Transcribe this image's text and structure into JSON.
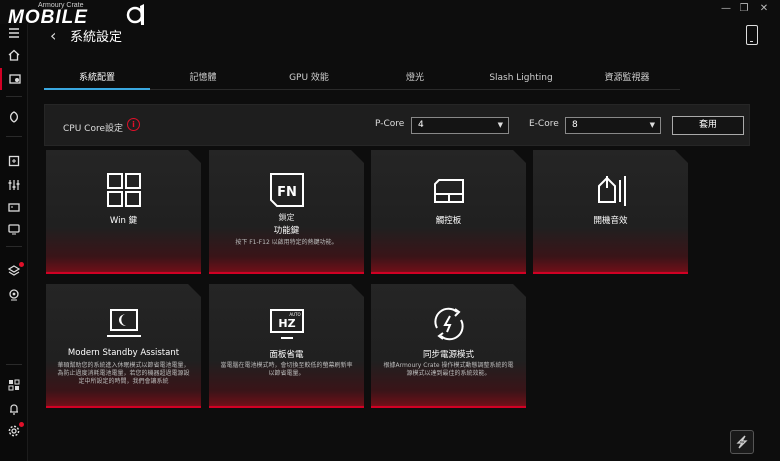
{
  "app": {
    "name": "Armoury Crate",
    "logo_text": "MOBILE"
  },
  "window_controls": {
    "minimize": "—",
    "restore": "❐",
    "close": "✕"
  },
  "header": {
    "back": "‹",
    "title": "系統設定"
  },
  "tabs": [
    {
      "label": "系統配置",
      "active": true
    },
    {
      "label": "記憶體",
      "active": false
    },
    {
      "label": "GPU 效能",
      "active": false
    },
    {
      "label": "燈光",
      "active": false
    },
    {
      "label": "Slash Lighting",
      "active": false
    },
    {
      "label": "資源監視器",
      "active": false
    }
  ],
  "config": {
    "label": "CPU Core設定",
    "info": "i",
    "pcore_label": "P-Core",
    "pcore_value": "4",
    "ecore_label": "E-Core",
    "ecore_value": "8",
    "caret": "▼",
    "apply_label": "套用"
  },
  "cards": [
    {
      "icon": "windows-grid-icon",
      "title": "Win 鍵",
      "subtitle": "",
      "desc": ""
    },
    {
      "icon": "fn-key-icon",
      "title": "鎖定",
      "subtitle": "功能鍵",
      "desc": "按下 F1-F12 以啟用特定的熱鍵功能。"
    },
    {
      "icon": "touchpad-icon",
      "title": "觸控板",
      "subtitle": "",
      "desc": ""
    },
    {
      "icon": "boot-sound-icon",
      "title": "開機音效",
      "subtitle": "",
      "desc": ""
    },
    {
      "icon": "modern-standby-icon",
      "title": "Modern Standby Assistant",
      "subtitle": "",
      "desc": "華碩幫助您的系統進入休眠模式以節省電池電量，為防止過度消耗電池電量，若您的機器超過電源設定中所設定的時間，我們會讓系統"
    },
    {
      "icon": "panel-power-saver-icon",
      "title": "面板省電",
      "subtitle": "",
      "desc": "當電腦在電池模式時，會切換至較低的螢幕刷新率以節省電量。"
    },
    {
      "icon": "sync-power-mode-icon",
      "title": "同步電源模式",
      "subtitle": "",
      "desc": "根據Armoury Crate 操作模式動態調整系統的電源模式以達到最佳的系統效能。"
    }
  ],
  "colors": {
    "accent": "#d10024",
    "tab_active": "#3aa8e0",
    "background": "#0d0d0d",
    "card": "#232323"
  }
}
